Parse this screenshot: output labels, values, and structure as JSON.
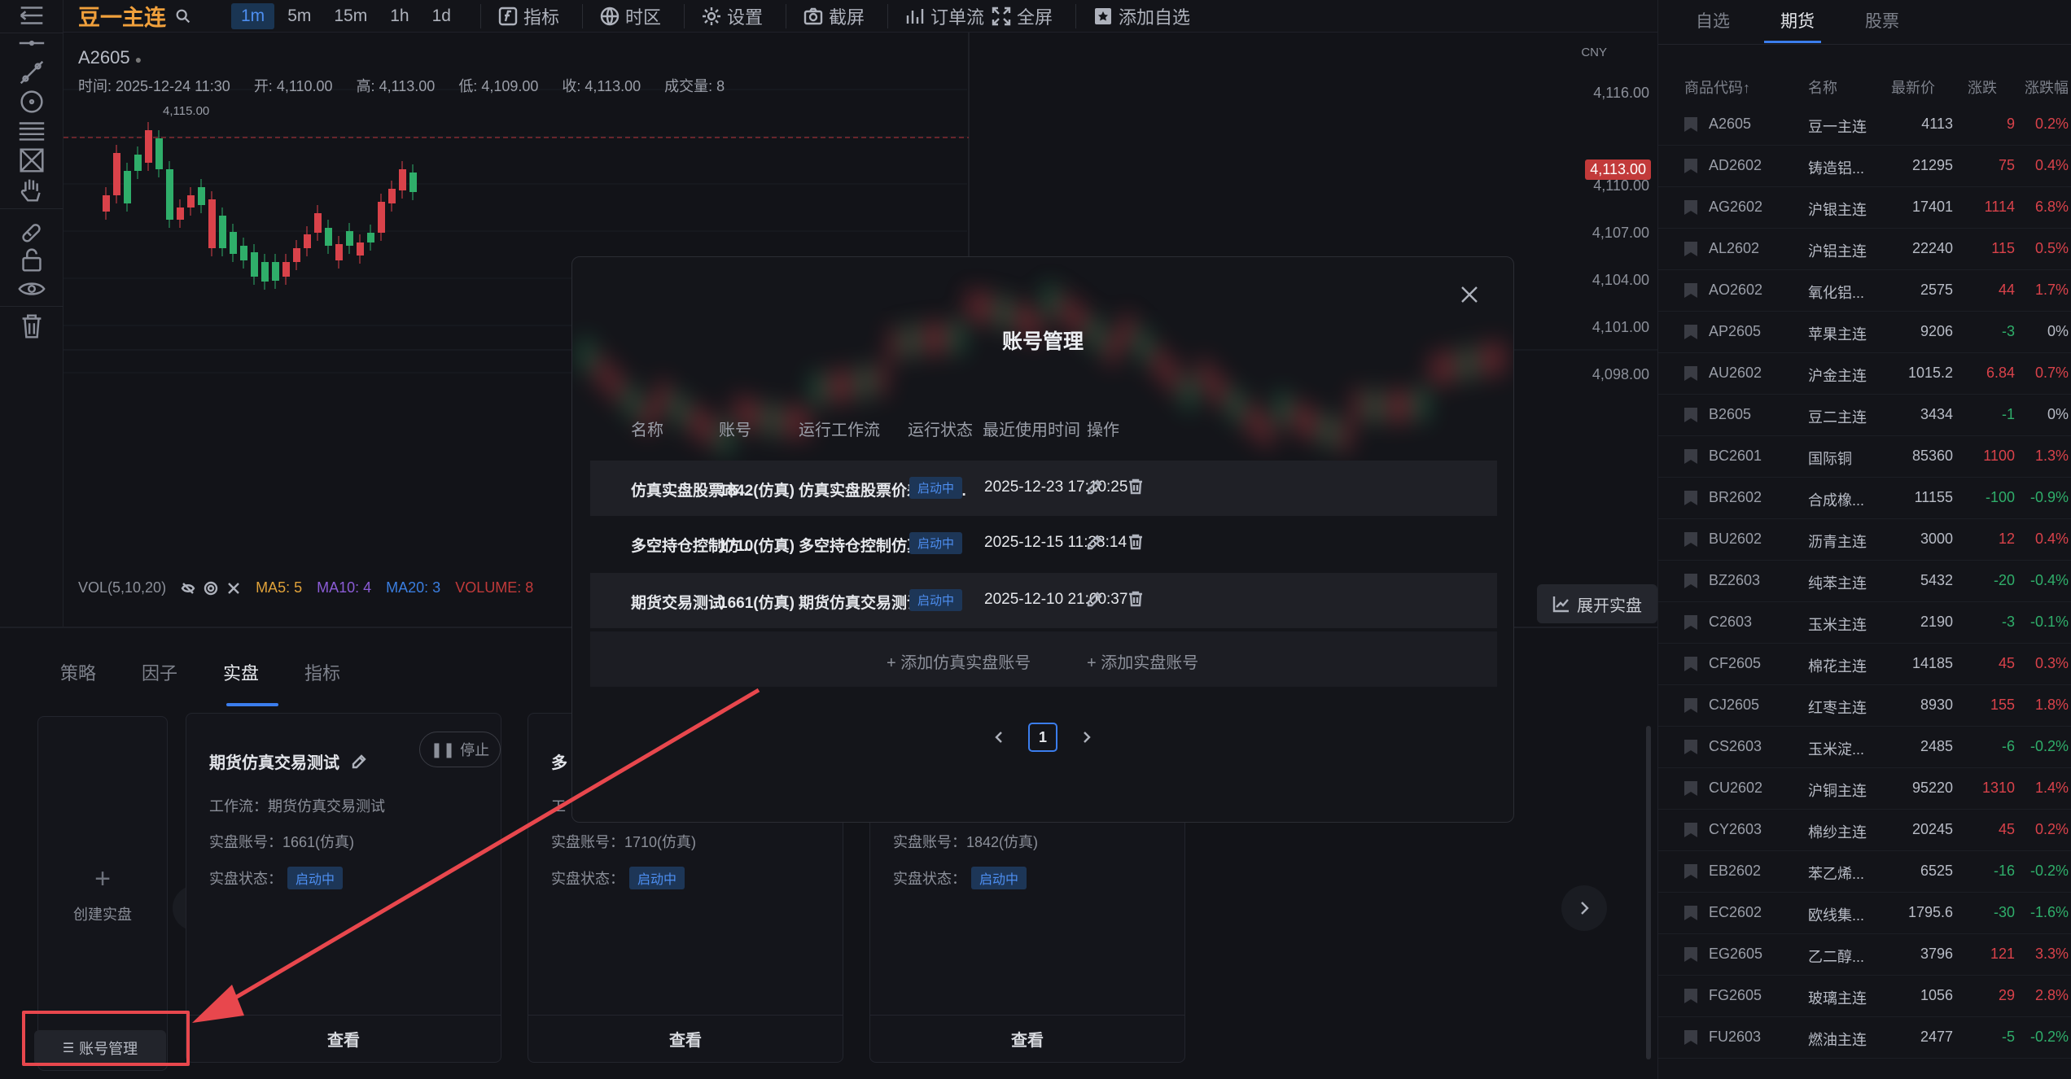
{
  "toolbar": {
    "symbol": "豆一主连",
    "intervals": [
      "1m",
      "5m",
      "15m",
      "1h",
      "1d"
    ],
    "buttons": {
      "indicator": "指标",
      "timezone": "时区",
      "settings": "设置",
      "screenshot": "截屏",
      "orderflow": "订单流",
      "fullscreen": "全屏",
      "add_watch": "添加自选"
    }
  },
  "chart": {
    "title": "A2605",
    "ohlc": {
      "time": "时间: 2025-12-24 11:30",
      "open": "开: 4,110.00",
      "high": "高: 4,113.00",
      "low": "低: 4,109.00",
      "close": "收: 4,113.00",
      "volume": "成交量: 8"
    },
    "currency": "CNY",
    "price_labels": [
      "4,116.00",
      "4,110.00",
      "4,107.00",
      "4,104.00",
      "4,101.00",
      "4,098.00"
    ],
    "last_price": "4,113.00",
    "high_marker": "4,115.00",
    "vol_title": "VOL(5,10,20)",
    "ma5": "MA5: 5",
    "ma10": "MA10: 4",
    "ma20": "MA20: 3",
    "volume": "VOLUME: 8",
    "expand": "展开实盘",
    "colors": {
      "up": "#d9424a",
      "down": "#2fae6a",
      "last_line": "#b8323a"
    }
  },
  "bottom": {
    "tabs": [
      "策略",
      "因子",
      "实盘",
      "指标"
    ],
    "active_tab": "实盘",
    "create": "创建实盘",
    "account_mgr": "账号管理",
    "cards": [
      {
        "title": "期货仿真交易测试",
        "stop": "停止",
        "workflow": "工作流：期货仿真交易测试",
        "account": "实盘账号：1661(仿真)",
        "status_label": "实盘状态：",
        "status": "启动中",
        "view": "查看"
      },
      {
        "title": "多",
        "workflow": "工",
        "account": "实盘账号：1710(仿真)",
        "status_label": "实盘状态：",
        "status": "启动中",
        "view": "查看"
      },
      {
        "account": "实盘账号：1842(仿真)",
        "status_label": "实盘状态：",
        "status": "启动中",
        "view": "查看"
      }
    ]
  },
  "watchlist": {
    "tabs": [
      "自选",
      "期货",
      "股票"
    ],
    "active_tab": "期货",
    "headers": [
      "商品代码↑",
      "名称",
      "最新价",
      "涨跌",
      "涨跌幅"
    ],
    "rows": [
      {
        "code": "A2605",
        "name": "豆一主连",
        "price": "4113",
        "chg": "9",
        "pct": "0.2%",
        "dir": "up"
      },
      {
        "code": "AD2602",
        "name": "铸造铝...",
        "price": "21295",
        "chg": "75",
        "pct": "0.4%",
        "dir": "up"
      },
      {
        "code": "AG2602",
        "name": "沪银主连",
        "price": "17401",
        "chg": "1114",
        "pct": "6.8%",
        "dir": "up"
      },
      {
        "code": "AL2602",
        "name": "沪铝主连",
        "price": "22240",
        "chg": "115",
        "pct": "0.5%",
        "dir": "up"
      },
      {
        "code": "AO2602",
        "name": "氧化铝...",
        "price": "2575",
        "chg": "44",
        "pct": "1.7%",
        "dir": "up"
      },
      {
        "code": "AP2605",
        "name": "苹果主连",
        "price": "9206",
        "chg": "-3",
        "pct": "0%",
        "dir": "down"
      },
      {
        "code": "AU2602",
        "name": "沪金主连",
        "price": "1015.2",
        "chg": "6.84",
        "pct": "0.7%",
        "dir": "up"
      },
      {
        "code": "B2605",
        "name": "豆二主连",
        "price": "3434",
        "chg": "-1",
        "pct": "0%",
        "dir": "down"
      },
      {
        "code": "BC2601",
        "name": "国际铜",
        "price": "85360",
        "chg": "1100",
        "pct": "1.3%",
        "dir": "up"
      },
      {
        "code": "BR2602",
        "name": "合成橡...",
        "price": "11155",
        "chg": "-100",
        "pct": "-0.9%",
        "dir": "down"
      },
      {
        "code": "BU2602",
        "name": "沥青主连",
        "price": "3000",
        "chg": "12",
        "pct": "0.4%",
        "dir": "up"
      },
      {
        "code": "BZ2603",
        "name": "纯苯主连",
        "price": "5432",
        "chg": "-20",
        "pct": "-0.4%",
        "dir": "down"
      },
      {
        "code": "C2603",
        "name": "玉米主连",
        "price": "2190",
        "chg": "-3",
        "pct": "-0.1%",
        "dir": "down"
      },
      {
        "code": "CF2605",
        "name": "棉花主连",
        "price": "14185",
        "chg": "45",
        "pct": "0.3%",
        "dir": "up"
      },
      {
        "code": "CJ2605",
        "name": "红枣主连",
        "price": "8930",
        "chg": "155",
        "pct": "1.8%",
        "dir": "up"
      },
      {
        "code": "CS2603",
        "name": "玉米淀...",
        "price": "2485",
        "chg": "-6",
        "pct": "-0.2%",
        "dir": "down"
      },
      {
        "code": "CU2602",
        "name": "沪铜主连",
        "price": "95220",
        "chg": "1310",
        "pct": "1.4%",
        "dir": "up"
      },
      {
        "code": "CY2603",
        "name": "棉纱主连",
        "price": "20245",
        "chg": "45",
        "pct": "0.2%",
        "dir": "up"
      },
      {
        "code": "EB2602",
        "name": "苯乙烯...",
        "price": "6525",
        "chg": "-16",
        "pct": "-0.2%",
        "dir": "down"
      },
      {
        "code": "EC2602",
        "name": "欧线集...",
        "price": "1795.6",
        "chg": "-30",
        "pct": "-1.6%",
        "dir": "down"
      },
      {
        "code": "EG2605",
        "name": "乙二醇...",
        "price": "3796",
        "chg": "121",
        "pct": "3.3%",
        "dir": "up"
      },
      {
        "code": "FG2605",
        "name": "玻璃主连",
        "price": "1056",
        "chg": "29",
        "pct": "2.8%",
        "dir": "up"
      },
      {
        "code": "FU2603",
        "name": "燃油主连",
        "price": "2477",
        "chg": "-5",
        "pct": "-0.2%",
        "dir": "down"
      }
    ]
  },
  "modal": {
    "title": "账号管理",
    "headers": [
      "名称",
      "账号",
      "运行工作流",
      "运行状态",
      "最近使用时间",
      "操作"
    ],
    "rows": [
      {
        "name": "仿真实盘股票市...",
        "account": "1842(仿真)",
        "workflow": "仿真实盘股票价差套利...",
        "status": "启动中",
        "time": "2025-12-23 17:10:25"
      },
      {
        "name": "多空持仓控制仿...",
        "account": "1710(仿真)",
        "workflow": "多空持仓控制仿真",
        "status": "启动中",
        "time": "2025-12-15 11:33:14"
      },
      {
        "name": "期货交易测试",
        "account": "1661(仿真)",
        "workflow": "期货仿真交易测试",
        "status": "启动中",
        "time": "2025-12-10 21:00:37"
      }
    ],
    "add_sim": "+ 添加仿真实盘账号",
    "add_real": "+ 添加实盘账号",
    "page": "1"
  }
}
